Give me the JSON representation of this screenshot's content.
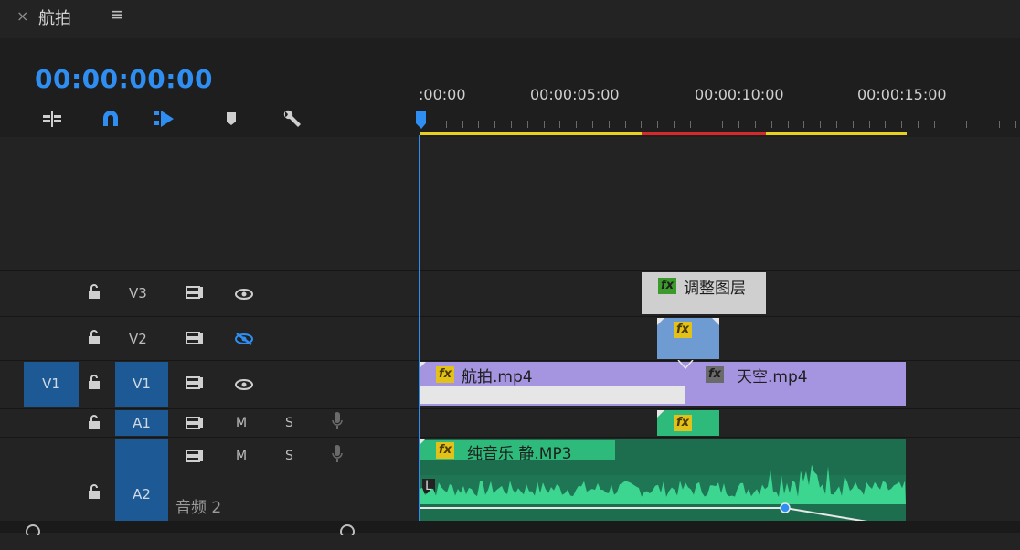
{
  "panel": {
    "close_glyph": "×",
    "title": "航拍",
    "menu_glyph": "≡"
  },
  "timecode": "00:00:00:00",
  "toolbar": {
    "tools": [
      "insert-sequence-icon",
      "snap-magnet-icon",
      "linked-selection-icon",
      "add-marker-icon",
      "wrench-settings-icon"
    ]
  },
  "ruler": {
    "labels": [
      ":00:00",
      "00:00:05:00",
      "00:00:10:00",
      "00:00:15:00"
    ]
  },
  "tracks": {
    "v3": {
      "name": "V3"
    },
    "v2": {
      "name": "V2"
    },
    "v1": {
      "patch": "V1",
      "name": "V1"
    },
    "a1": {
      "name": "A1",
      "mute": "M",
      "solo": "S"
    },
    "a2": {
      "name": "A2",
      "mute": "M",
      "solo": "S",
      "label": "音频 2"
    }
  },
  "clips": {
    "adjustment": {
      "fx": "fx",
      "label": "调整图层"
    },
    "v2_clip": {
      "fx": "fx"
    },
    "hangpai": {
      "fx": "fx",
      "label": "航拍.mp4"
    },
    "tiankong": {
      "fx": "fx",
      "label": "天空.mp4"
    },
    "a1_clip": {
      "fx": "fx"
    },
    "music": {
      "fx": "fx",
      "label": "纯音乐 静.MP3",
      "channel": "L"
    }
  },
  "colors": {
    "accent_blue": "#2e8ef2",
    "render_yellow": "#e6d21e",
    "render_red": "#d62a2a",
    "video_clip": "#a594e0",
    "audio_clip": "#1c6e4f",
    "waveform": "#3cd690"
  }
}
